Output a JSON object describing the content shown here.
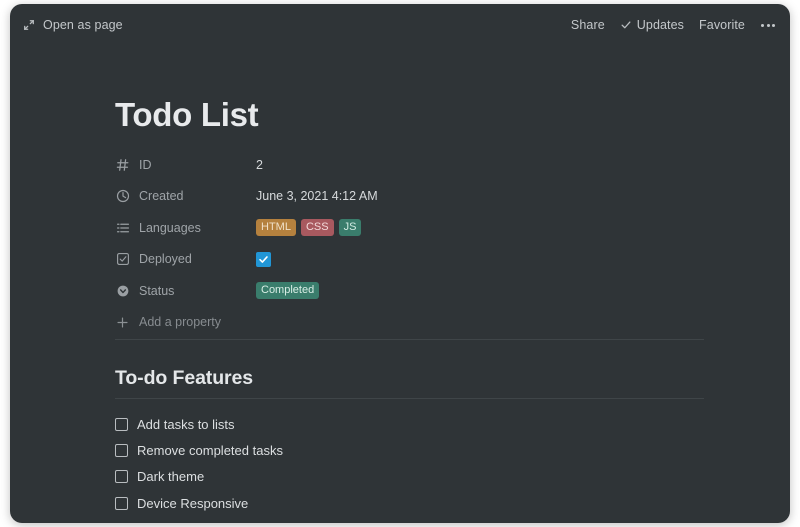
{
  "topbar": {
    "open_as_page": "Open as page",
    "share": "Share",
    "updates": "Updates",
    "favorite": "Favorite",
    "more": "•••"
  },
  "page": {
    "title": "Todo List",
    "background_color": "#2f3437"
  },
  "properties": {
    "rows": [
      {
        "icon": "hash-icon",
        "label": "ID",
        "value": "2"
      },
      {
        "icon": "clock-icon",
        "label": "Created",
        "value": "June 3, 2021 4:12 AM"
      },
      {
        "icon": "list-icon",
        "label": "Languages",
        "value": ""
      },
      {
        "icon": "checkbox-icon",
        "label": "Deployed",
        "value": ""
      },
      {
        "icon": "select-icon",
        "label": "Status",
        "value": ""
      }
    ],
    "languages": [
      {
        "label": "HTML",
        "bg": "#b5813e",
        "fg": "#f0e0c8"
      },
      {
        "label": "CSS",
        "bg": "#a8595f",
        "fg": "#f3d9da"
      },
      {
        "label": "JS",
        "bg": "#3a7d6c",
        "fg": "#d2ece3"
      }
    ],
    "deployed_checked": true,
    "status": {
      "label": "Completed",
      "bg": "#3a7d6c",
      "fg": "#d9eee6"
    },
    "add_property": "Add a property"
  },
  "content": {
    "section_heading": "To-do Features",
    "todos": [
      {
        "label": "Add tasks to lists",
        "checked": false
      },
      {
        "label": "Remove completed tasks",
        "checked": false
      },
      {
        "label": "Dark theme",
        "checked": false
      },
      {
        "label": "Device Responsive",
        "checked": false
      }
    ]
  }
}
